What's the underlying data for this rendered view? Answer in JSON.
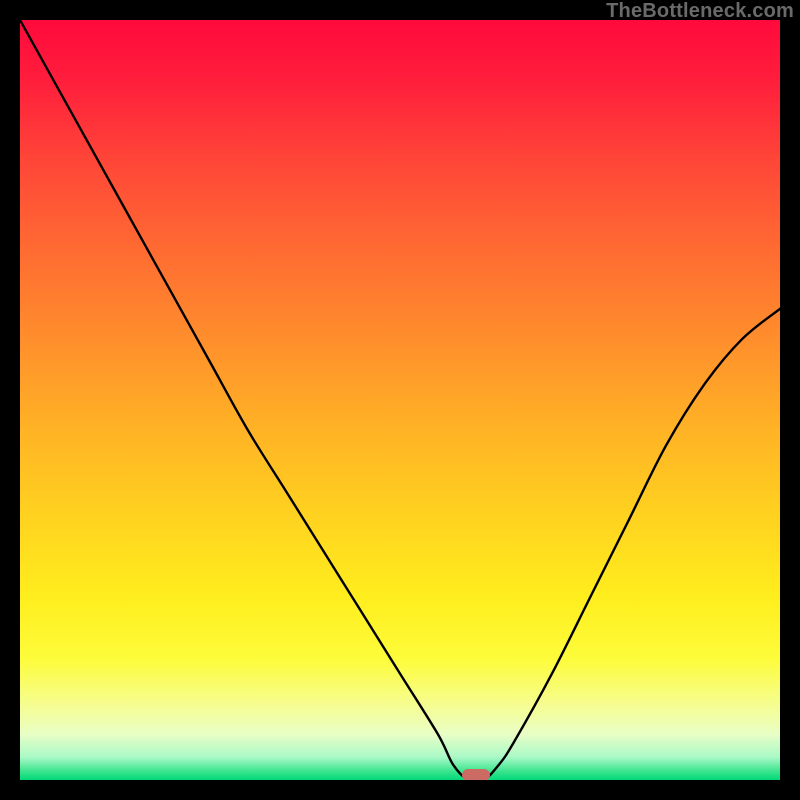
{
  "attribution": "TheBottleneck.com",
  "colors": {
    "marker": "#cc6b63",
    "curve": "#000000"
  },
  "chart_data": {
    "type": "line",
    "title": "",
    "xlabel": "",
    "ylabel": "",
    "xlim": [
      0,
      100
    ],
    "ylim": [
      0,
      100
    ],
    "grid": false,
    "legend": false,
    "series": [
      {
        "name": "bottleneck-curve",
        "x": [
          0,
          5,
          10,
          15,
          20,
          25,
          30,
          35,
          40,
          45,
          50,
          55,
          57,
          59,
          61,
          63,
          65,
          70,
          75,
          80,
          85,
          90,
          95,
          100
        ],
        "values": [
          100,
          91,
          82,
          73,
          64,
          55,
          46,
          38,
          30,
          22,
          14,
          6,
          2,
          0,
          0,
          2,
          5,
          14,
          24,
          34,
          44,
          52,
          58,
          62
        ]
      }
    ],
    "annotations": [
      {
        "name": "optimal-marker",
        "x": 60,
        "y": 0.7
      }
    ]
  }
}
